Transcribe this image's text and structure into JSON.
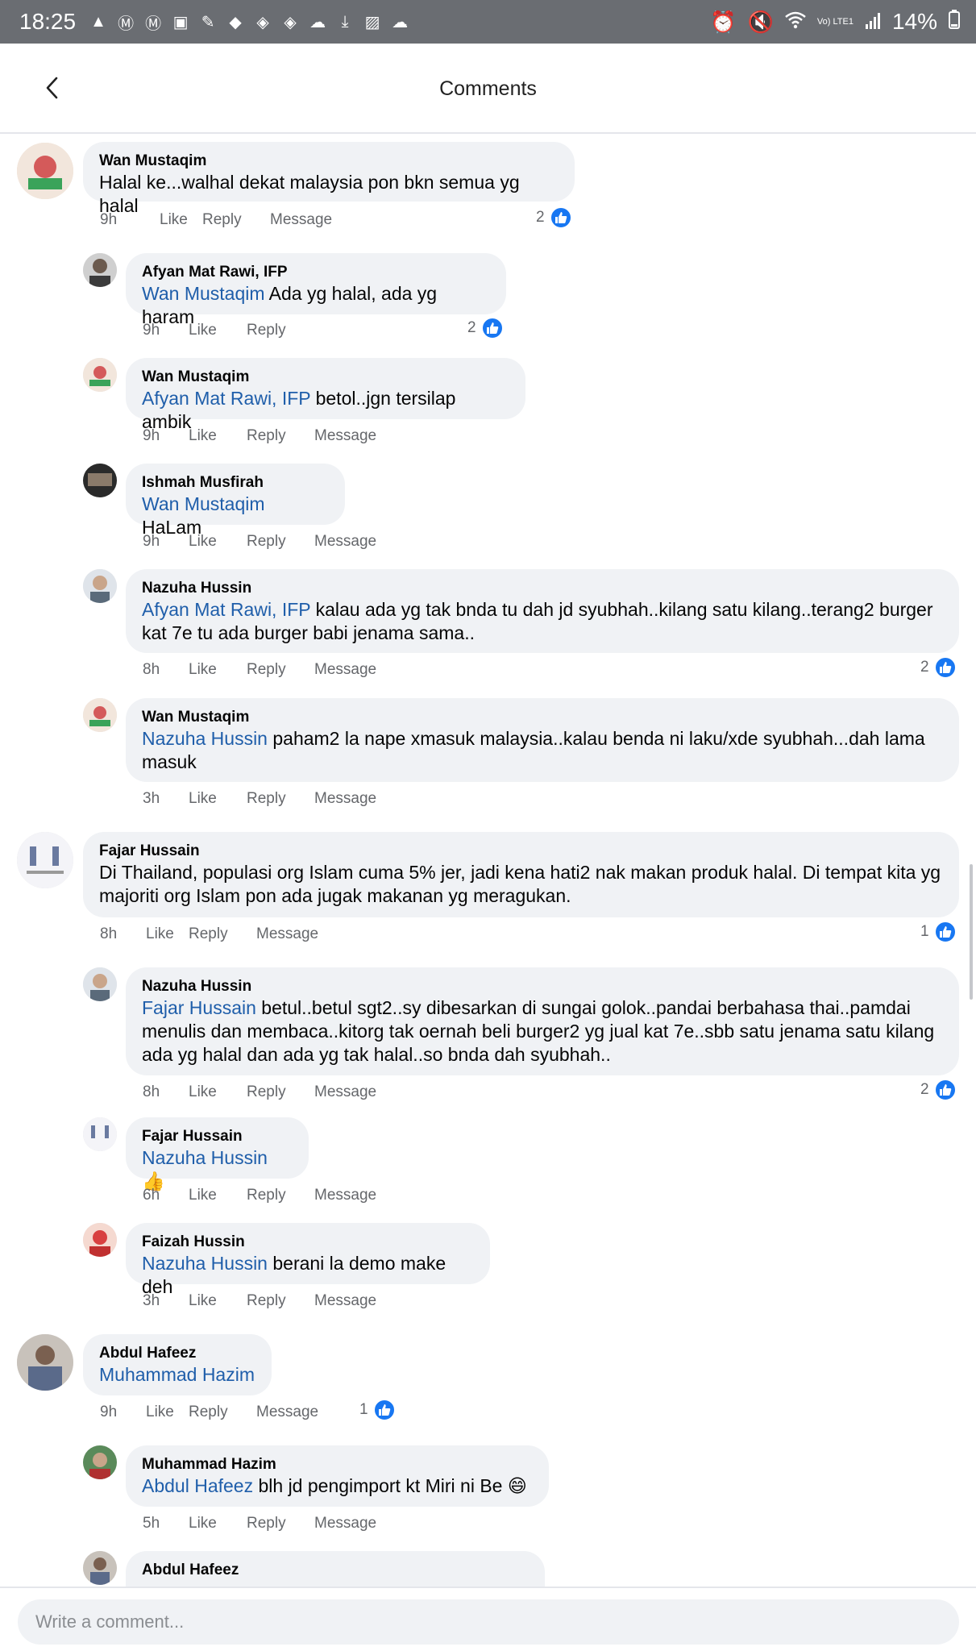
{
  "status": {
    "time": "18:25",
    "network": "Vo) LTE1",
    "battery": "14%"
  },
  "header": {
    "title": "Comments"
  },
  "composer": {
    "placeholder": "Write a comment..."
  },
  "labels": {
    "like": "Like",
    "reply": "Reply",
    "message": "Message"
  },
  "comments": [
    {
      "name": "Wan Mustaqim",
      "text": "Halal ke...walhal dekat malaysia pon bkn semua yg halal",
      "time": "9h",
      "reactions": "2"
    },
    {
      "name": "Afyan Mat Rawi, IFP",
      "mention": "Wan Mustaqim",
      "text": " Ada yg halal, ada yg haram",
      "time": "9h",
      "reactions": "2"
    },
    {
      "name": "Wan Mustaqim",
      "mention": "Afyan Mat Rawi, IFP",
      "text": " betol..jgn tersilap ambik",
      "time": "9h"
    },
    {
      "name": "Ishmah Musfirah",
      "mention": "Wan Mustaqim",
      "text": " HaLam",
      "time": "9h"
    },
    {
      "name": "Nazuha Hussin",
      "mention": "Afyan Mat Rawi, IFP",
      "text": " kalau ada yg tak bnda tu dah jd syubhah..kilang satu kilang..terang2 burger",
      "text2": "kat 7e tu ada burger babi jenama sama..",
      "time": "8h",
      "reactions": "2"
    },
    {
      "name": "Wan Mustaqim",
      "mention": "Nazuha Hussin",
      "text": " paham2 la nape xmasuk malaysia..kalau benda ni laku/xde syubhah...dah lama",
      "text2": "masuk",
      "time": "3h"
    },
    {
      "name": "Fajar Hussain",
      "text": "Di Thailand, populasi org Islam cuma 5% jer, jadi kena hati2 nak makan produk halal. Di tempat kita yg",
      "text2": "majoriti org Islam pon ada jugak makanan yg meragukan.",
      "time": "8h",
      "reactions": "1"
    },
    {
      "name": "Nazuha Hussin",
      "mention": "Fajar Hussain",
      "text": " betul..betul sgt2..sy dibesarkan di sungai golok..pandai berbahasa thai..pamdai",
      "text2": "menulis dan membaca..kitorg tak oernah beli burger2 yg jual kat 7e..sbb satu jenama satu kilang",
      "text3": "ada yg halal dan ada yg tak halal..so bnda dah syubhah..",
      "time": "8h",
      "reactions": "2"
    },
    {
      "name": "Fajar Hussain",
      "mention": "Nazuha Hussin",
      "text": " 👍",
      "time": "6h"
    },
    {
      "name": "Faizah Hussin",
      "mention": "Nazuha Hussin",
      "text": " berani la demo make deh",
      "time": "3h"
    },
    {
      "name": "Abdul Hafeez",
      "mention": "Muhammad Hazim",
      "text": "",
      "time": "9h",
      "reactions": "1"
    },
    {
      "name": "Muhammad Hazim",
      "mention": "Abdul Hafeez",
      "text": " blh jd pengimport kt Miri ni Be 😄",
      "time": "5h"
    },
    {
      "name": "Abdul Hafeez"
    }
  ],
  "colors": {
    "mention": "#1f5eaa",
    "bubble": "#f0f2f5",
    "like_badge": "#1877f2",
    "statusbar": "#6a6d72"
  },
  "icons": {
    "back": "chevron-left-icon",
    "like": "thumbs-up-icon"
  }
}
